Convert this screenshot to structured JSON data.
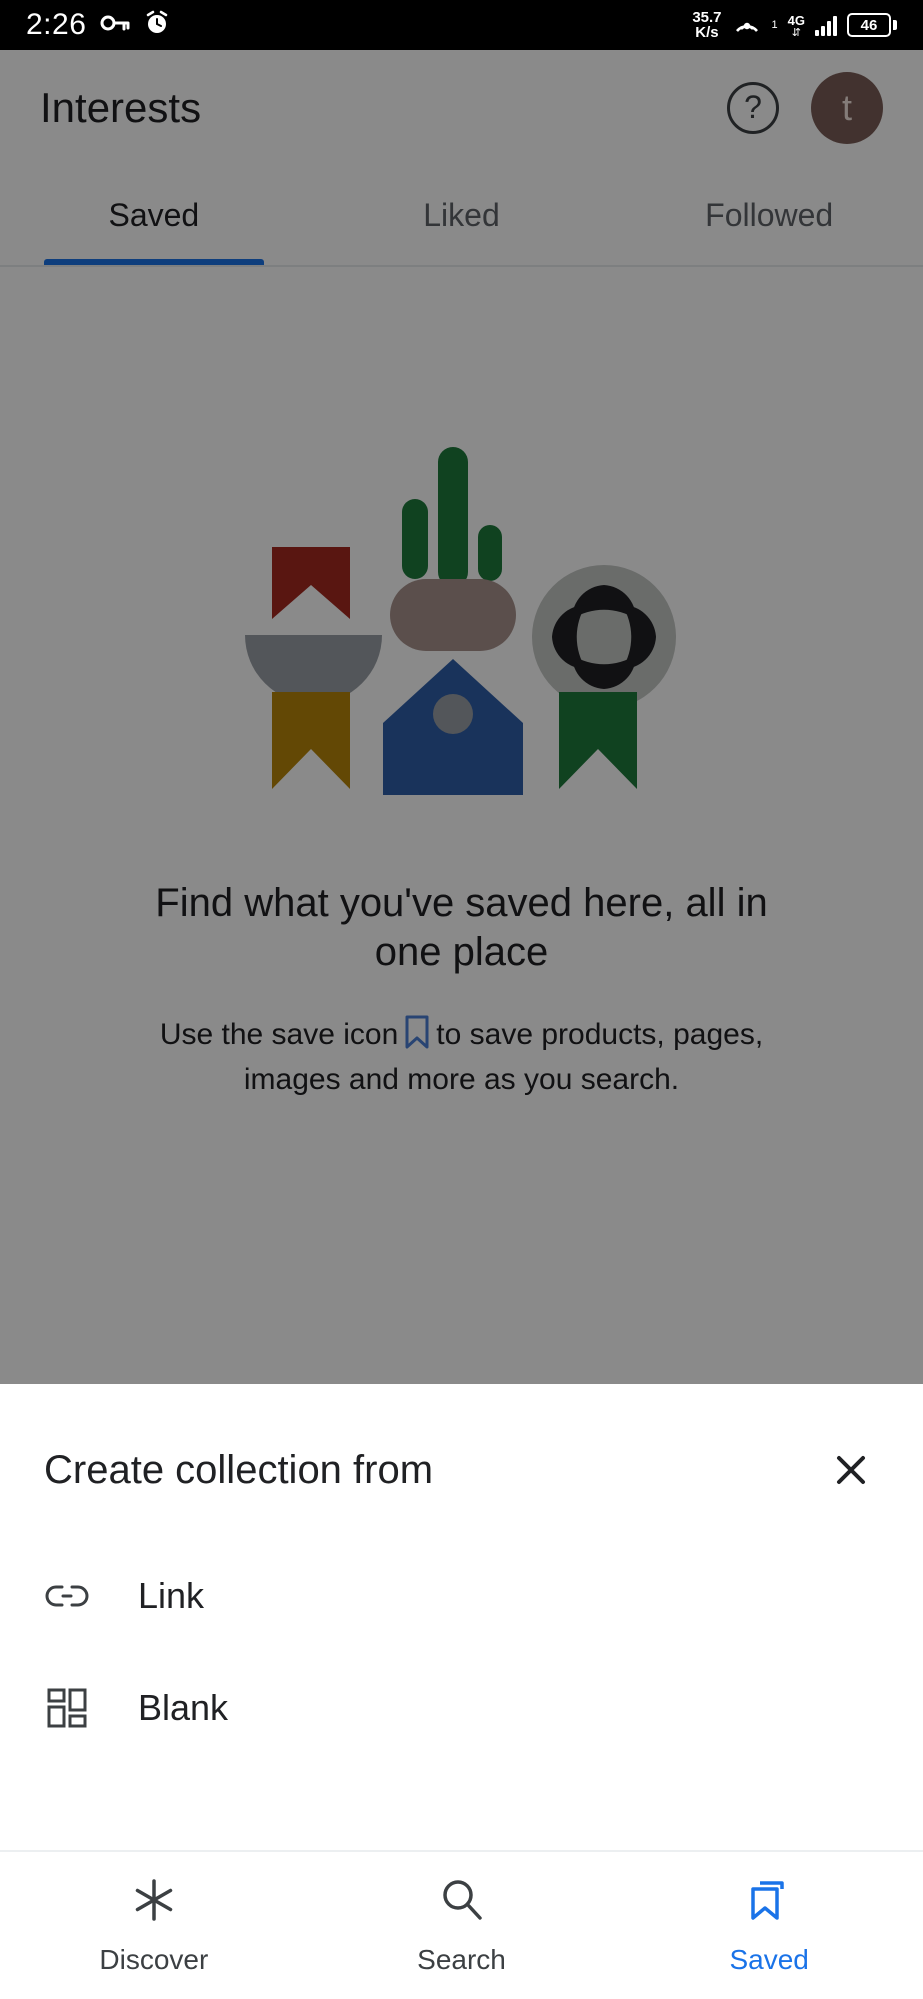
{
  "statusbar": {
    "time": "2:26",
    "vpn_icon": "key-icon",
    "alarm_icon": "alarm-icon",
    "net_speed_value": "35.7",
    "net_speed_unit": "K/s",
    "hotspot_icon": "hotspot-icon",
    "sim_index": "1",
    "network_type": "4G",
    "signal_icon": "signal-bars-icon",
    "battery_percent": "46"
  },
  "appbar": {
    "title": "Interests",
    "help_icon": "help-circle-icon",
    "help_glyph": "?",
    "avatar_letter": "t",
    "avatar_color": "#7a5d57"
  },
  "tabs": {
    "items": [
      {
        "label": "Saved",
        "active": true
      },
      {
        "label": "Liked",
        "active": false
      },
      {
        "label": "Followed",
        "active": false
      }
    ],
    "indicator_color": "#1a73e8"
  },
  "empty_state": {
    "illustration_name": "saved-items-illustration",
    "title": "Find what you've saved here, all in one place",
    "subtitle_before": "Use the save icon",
    "subtitle_icon": "bookmark-icon",
    "subtitle_after": "to save products, pages, images and more as you search.",
    "colors": {
      "bookmark_red": "#a52a21",
      "bookmark_yellow": "#b8860b",
      "bookmark_green": "#1e7a3c",
      "cactus_green": "#1e7a3c",
      "house_blue": "#2f5fa8",
      "bowl_gray": "#9aa0a6",
      "pot_mauve": "#a8928c",
      "wheel_gray": "#c4c7c5",
      "wheel_dark": "#202124",
      "inline_bookmark_blue": "#4a7fd4"
    }
  },
  "sheet": {
    "title": "Create collection from",
    "close_icon": "close-icon",
    "close_glyph": "✕",
    "items": [
      {
        "label": "Link",
        "icon": "link-icon"
      },
      {
        "label": "Blank",
        "icon": "dashboard-grid-icon"
      }
    ]
  },
  "bottomnav": {
    "items": [
      {
        "label": "Discover",
        "icon": "asterisk-icon",
        "active": false
      },
      {
        "label": "Search",
        "icon": "search-icon",
        "active": false
      },
      {
        "label": "Saved",
        "icon": "bookmarks-stack-icon",
        "active": true
      }
    ],
    "active_color": "#1a73e8"
  }
}
